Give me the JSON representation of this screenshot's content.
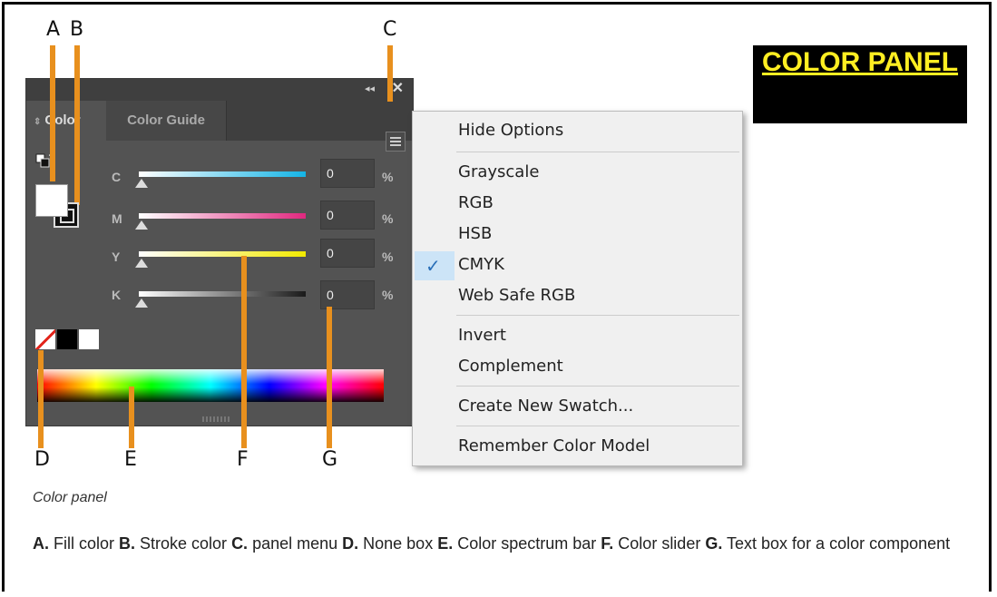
{
  "badge": {
    "title": "COLOR PANEL"
  },
  "callouts": {
    "a": "A",
    "b": "B",
    "c": "C",
    "d": "D",
    "e": "E",
    "f": "F",
    "g": "G"
  },
  "panel": {
    "tabs": [
      {
        "label": "Color",
        "active": true
      },
      {
        "label": "Color Guide",
        "active": false
      }
    ],
    "rows": [
      {
        "label": "C",
        "value": "0",
        "unit": "%",
        "gradient": [
          "#ffffff",
          "#14b4e6"
        ]
      },
      {
        "label": "M",
        "value": "0",
        "unit": "%",
        "gradient": [
          "#ffffff",
          "#e0287f"
        ]
      },
      {
        "label": "Y",
        "value": "0",
        "unit": "%",
        "gradient": [
          "#ffffff",
          "#f2ea00"
        ]
      },
      {
        "label": "K",
        "value": "0",
        "unit": "%",
        "gradient": [
          "#ffffff",
          "#1a1a1a"
        ]
      }
    ],
    "icons": [
      "collapse-icon",
      "close-icon",
      "hamburger-menu-icon",
      "swap-icon",
      "none-icon"
    ]
  },
  "menu": {
    "items": [
      "Hide Options",
      "Grayscale",
      "RGB",
      "HSB",
      "CMYK",
      "Web Safe RGB",
      "Invert",
      "Complement",
      "Create New Swatch...",
      "Remember Color Model"
    ],
    "checked": "CMYK"
  },
  "caption": "Color panel",
  "legend": [
    {
      "key": "A.",
      "text": " Fill color "
    },
    {
      "key": "B.",
      "text": " Stroke color "
    },
    {
      "key": "C.",
      "text": " panel menu "
    },
    {
      "key": "D.",
      "text": " None box "
    },
    {
      "key": "E.",
      "text": " Color spectrum bar "
    },
    {
      "key": "F.",
      "text": " Color slider "
    },
    {
      "key": "G.",
      "text": " Text box for a color component"
    }
  ],
  "colors": {
    "accent_leader": "#e8901e",
    "panel_bg": "#535353",
    "badge_text": "#ffee22",
    "check": "#2a6fb8"
  }
}
